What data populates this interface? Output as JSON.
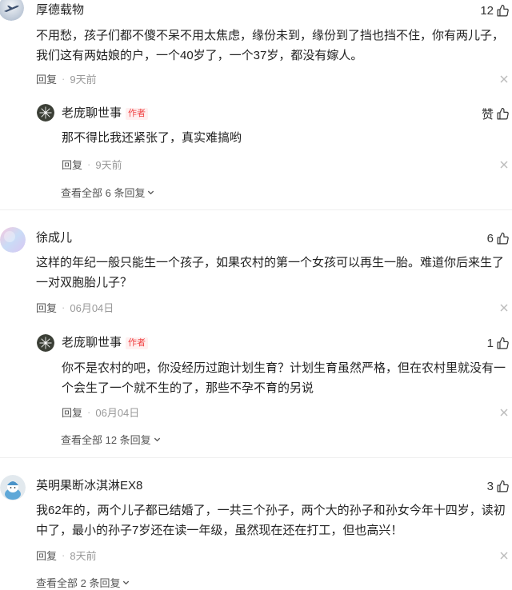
{
  "comments": [
    {
      "name": "厚德载物",
      "likes": "12",
      "text_lines": [
        "不用愁，孩子们都不傻不呆不用太焦虑，缘份未到，缘份到了挡也挡不住，你有两儿子，",
        "我们这有两姑娘的户，一个40岁了，一个37岁，都没有嫁人。"
      ],
      "reply_label": "回复",
      "separator": "·",
      "time": "9天前",
      "reply": {
        "name": "老庞聊世事",
        "badge": "作者",
        "likes": "赞",
        "text_lines": [
          "那不得比我还紧张了，真实难搞哟"
        ],
        "reply_label": "回复",
        "separator": "·",
        "time": "9天前"
      },
      "view_all": "查看全部 6 条回复"
    },
    {
      "name": "徐成儿",
      "likes": "6",
      "text_lines": [
        "这样的年纪一般只能生一个孩子，如果农村的第一个女孩可以再生一胎。难道你后来生了",
        "一对双胞胎儿子？"
      ],
      "reply_label": "回复",
      "separator": "·",
      "time": "06月04日",
      "reply": {
        "name": "老庞聊世事",
        "badge": "作者",
        "likes": "1",
        "text_lines": [
          "你不是农村的吧，你没经历过跑计划生育？计划生育虽然严格，但在农村里就没有一",
          "个会生了一个就不生的了，那些不孕不育的另说"
        ],
        "reply_label": "回复",
        "separator": "·",
        "time": "06月04日"
      },
      "view_all": "查看全部 12 条回复"
    },
    {
      "name": "英明果断冰淇淋EX8",
      "likes": "3",
      "text_lines": [
        "我62年的，两个儿子都已结婚了，一共三个孙子，两个大的孙子和孙女今年十四岁，读初",
        "中了，最小的孙子7岁还在读一年级，虽然现在还在打工，但也高兴！"
      ],
      "reply_label": "回复",
      "separator": "·",
      "time": "8天前",
      "view_all": "查看全部 2 条回复"
    }
  ],
  "icons": {
    "like": "thumbs-up-icon",
    "dismiss": "close-icon",
    "expand": "chevron-down-icon"
  },
  "colors": {
    "author_badge_text": "#f04142",
    "author_badge_bg": "#fff0f0",
    "meta_text": "#999999"
  }
}
